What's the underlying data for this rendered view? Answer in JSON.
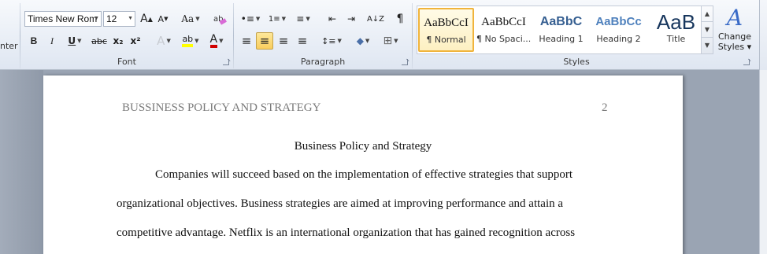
{
  "ribbon": {
    "clipboard_fragment": "nter",
    "font": {
      "label": "Font",
      "font_name": "Times New Rom",
      "font_size": "12",
      "grow": "A",
      "shrink": "A",
      "change_case": "Aa",
      "bold": "B",
      "italic": "I",
      "underline": "U",
      "strike": "abc",
      "subscript": "x₂",
      "superscript": "x²",
      "effects": "A",
      "highlight": "ab",
      "font_color": "A",
      "font_color_value": "#d00000",
      "highlight_value": "#ffff00"
    },
    "paragraph": {
      "label": "Paragraph",
      "bullets": "•≡",
      "numbering": "1≡",
      "multilevel": "≡",
      "decrease_indent": "⇤",
      "increase_indent": "⇥",
      "sort": "A↓Z",
      "show_marks": "¶",
      "align_left": "≡",
      "align_center": "≡",
      "align_right": "≡",
      "justify": "≡",
      "line_spacing": "↕≡",
      "shading": "◆",
      "borders": "⊞"
    },
    "styles": {
      "label": "Styles",
      "items": [
        {
          "sample": "AaBbCcI",
          "name": "¶ Normal"
        },
        {
          "sample": "AaBbCcI",
          "name": "¶ No Spaci..."
        },
        {
          "sample": "AaBbC",
          "name": "Heading 1"
        },
        {
          "sample": "AaBbCc",
          "name": "Heading 2"
        },
        {
          "sample": "AaB",
          "name": "Title"
        }
      ],
      "change_styles_line1": "Change",
      "change_styles_line2": "Styles ▾",
      "accent": "#3a6bc7"
    }
  },
  "document": {
    "header_left": "BUSSINESS POLICY AND STRATEGY",
    "page_number": "2",
    "title": "Business Policy and Strategy",
    "lines": [
      "Companies will succeed based on the implementation of effective strategies that support",
      "organizational  objectives. Business strategies are aimed at improving  performance and attain a",
      "competitive advantage. Netflix is an international organization  that has gained recognition across"
    ]
  }
}
